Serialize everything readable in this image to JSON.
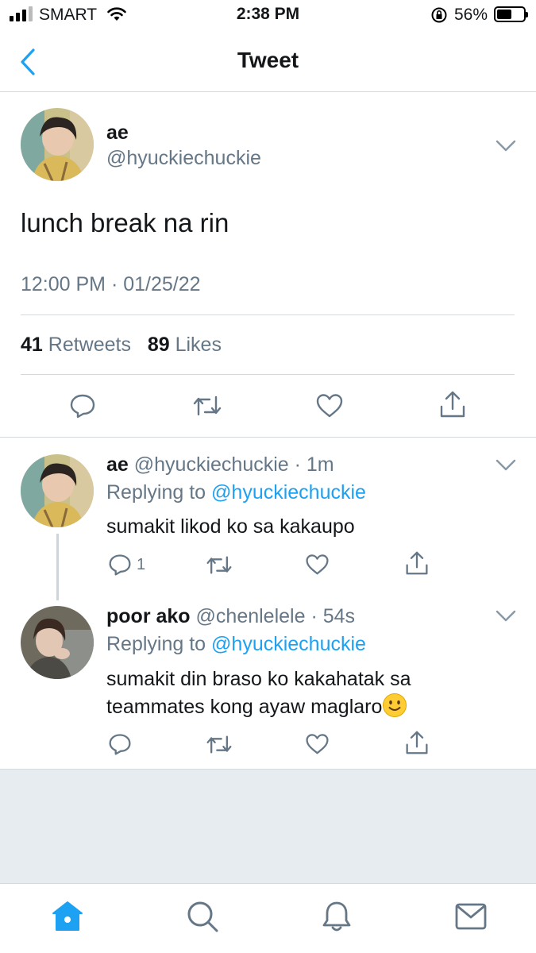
{
  "status_bar": {
    "carrier": "SMART",
    "time": "2:38 PM",
    "battery_percent": "56%",
    "battery_level": 0.56
  },
  "nav": {
    "title": "Tweet",
    "back_icon": "chevron-left-icon"
  },
  "tweet": {
    "author_name": "ae",
    "author_handle": "@hyuckiechuckie",
    "text": "lunch break na rin",
    "timestamp": "12:00 PM · 01/25/22",
    "retweet_count": "41",
    "retweet_label": "Retweets",
    "like_count": "89",
    "like_label": "Likes",
    "actions": [
      "reply-icon",
      "retweet-icon",
      "like-icon",
      "share-icon"
    ]
  },
  "replies": [
    {
      "name": "ae",
      "handle": "@hyuckiechuckie",
      "time": "1m",
      "replying_label": "Replying to",
      "replying_to": "@hyuckiechuckie",
      "text": "sumakit likod ko sa kakaupo",
      "reply_count": "1"
    },
    {
      "name": "poor ako",
      "handle": "@chenlelele",
      "time": "54s",
      "replying_label": "Replying to",
      "replying_to": "@hyuckiechuckie",
      "text_line1": "sumakit din braso ko kakahatak sa",
      "text_line2": "teammates kong ayaw maglaro",
      "emoji": "slightly-smiling-face"
    }
  ],
  "tabbar": {
    "items": [
      "home-icon",
      "search-icon",
      "notifications-icon",
      "messages-icon"
    ],
    "active": "home-icon"
  },
  "colors": {
    "accent": "#1da1f2",
    "text": "#14171a",
    "secondary": "#657786",
    "divider": "#d6d9db",
    "background_gray": "#e6ecf0"
  }
}
